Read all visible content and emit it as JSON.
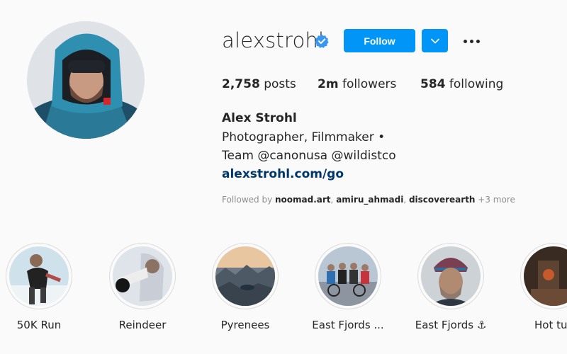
{
  "profile": {
    "username": "alexstrohl",
    "verified": true,
    "avatar_icon": "profile-photo-man-in-hood",
    "follow_label": "Follow",
    "dropdown_icon": "chevron-down-icon",
    "more_icon": "more-options-icon",
    "accent": "#0095f6"
  },
  "stats": {
    "posts_count": "2,758",
    "posts_label": "posts",
    "followers_count": "2m",
    "followers_label": "followers",
    "following_count": "584",
    "following_label": "following"
  },
  "bio": {
    "name": "Alex Strohl",
    "line1": "Photographer, Filmmaker •",
    "line2": "Team @canonusa @wildistco",
    "link": "alexstrohl.com/go"
  },
  "followed_by": {
    "prefix": "Followed by ",
    "users": [
      "noomad.art",
      "amiru_ahmadi",
      "discoverearth"
    ],
    "more": "+3 more"
  },
  "highlights": [
    {
      "label": "50K Run"
    },
    {
      "label": "Reindeer"
    },
    {
      "label": "Pyrenees"
    },
    {
      "label": "East Fjords ..."
    },
    {
      "label": "East Fjords ⚓"
    },
    {
      "label": "Hot tu"
    }
  ]
}
